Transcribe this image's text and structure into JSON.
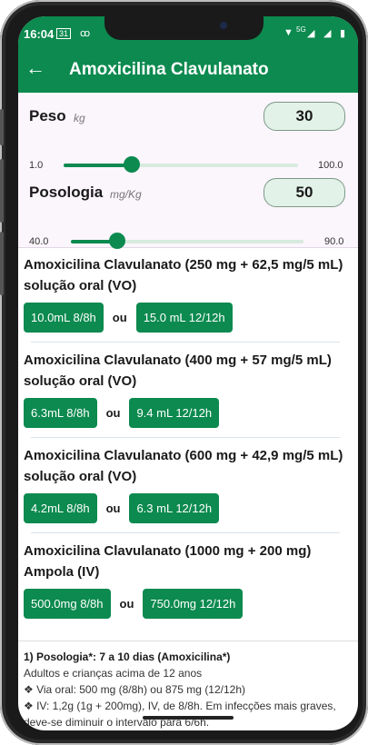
{
  "status": {
    "time": "16:04",
    "calendar": "31",
    "voicemail": "ꝏ",
    "network": "5G"
  },
  "appbar": {
    "title": "Amoxicilina Clavulanato"
  },
  "peso": {
    "label": "Peso",
    "unit": "kg",
    "value": "30",
    "min": "1.0",
    "max": "100.0",
    "level": 0.29
  },
  "posologia": {
    "label": "Posologia",
    "unit": "mg/Kg",
    "value": "50",
    "min": "40.0",
    "max": "90.0",
    "level": 0.2
  },
  "items": [
    {
      "title": "Amoxicilina Clavulanato (250 mg + 62,5 mg/5 mL) solução oral (VO)",
      "dose1": "10.0mL 8/8h",
      "ou": "ou",
      "dose2": "15.0 mL 12/12h"
    },
    {
      "title": "Amoxicilina Clavulanato (400 mg + 57 mg/5 mL) solução oral (VO)",
      "dose1": "6.3mL 8/8h",
      "ou": "ou",
      "dose2": "9.4 mL 12/12h"
    },
    {
      "title": "Amoxicilina Clavulanato (600 mg + 42,9 mg/5 mL) solução oral (VO)",
      "dose1": "4.2mL 8/8h",
      "ou": "ou",
      "dose2": "6.3 mL 12/12h"
    },
    {
      "title": "Amoxicilina Clavulanato (1000 mg + 200 mg) Ampola (IV)",
      "dose1": "500.0mg 8/8h",
      "ou": "ou",
      "dose2": "750.0mg 12/12h"
    }
  ],
  "notes": {
    "title": "1) Posologia*: 7 a 10 dias (Amoxicilina*)",
    "line1": "Adultos e crianças acima de 12 anos",
    "line2": "❖ Via oral: 500 mg (8/8h) ou 875 mg (12/12h)",
    "line3": "❖ IV: 1,2g (1g + 200mg), IV, de 8/8h. Em infecções mais graves, deve-se diminuir o intervalo para 6/6h."
  },
  "colors": {
    "primary": "#0c8a4f",
    "panel": "#fbf5fc",
    "valueBox": "#e3f2e9"
  }
}
